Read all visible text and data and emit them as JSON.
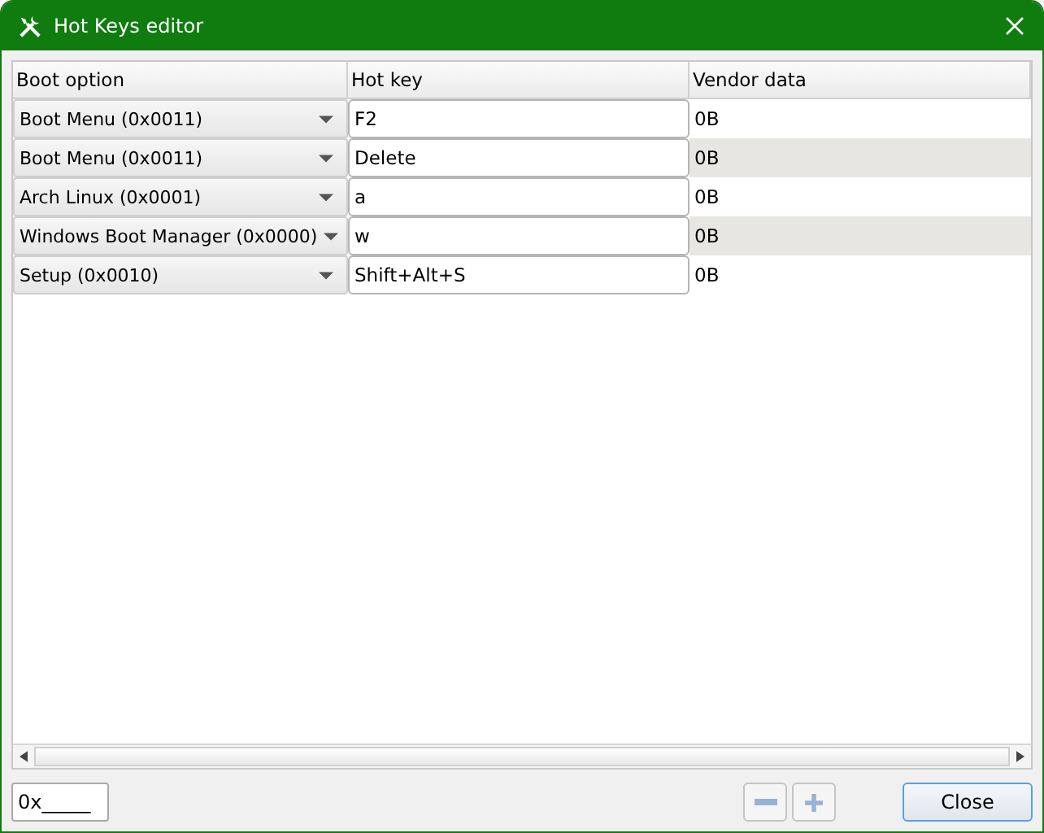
{
  "window": {
    "title": "Hot Keys editor"
  },
  "table": {
    "columns": [
      "Boot option",
      "Hot key",
      "Vendor data"
    ],
    "rows": [
      {
        "boot_option": "Boot Menu (0x0011)",
        "hot_key": "F2",
        "vendor_data": "0B"
      },
      {
        "boot_option": "Boot Menu (0x0011)",
        "hot_key": "Delete",
        "vendor_data": "0B"
      },
      {
        "boot_option": "Arch Linux (0x0001)",
        "hot_key": "a",
        "vendor_data": "0B"
      },
      {
        "boot_option": "Windows Boot Manager (0x0000)",
        "hot_key": "w",
        "vendor_data": "0B"
      },
      {
        "boot_option": "Setup (0x0010)",
        "hot_key": "Shift+Alt+S",
        "vendor_data": "0B"
      }
    ]
  },
  "footer": {
    "hex_field": {
      "value": "0x_____"
    },
    "remove_button": {
      "disabled": true
    },
    "add_button": {
      "disabled": true
    },
    "close_button": "Close"
  }
}
